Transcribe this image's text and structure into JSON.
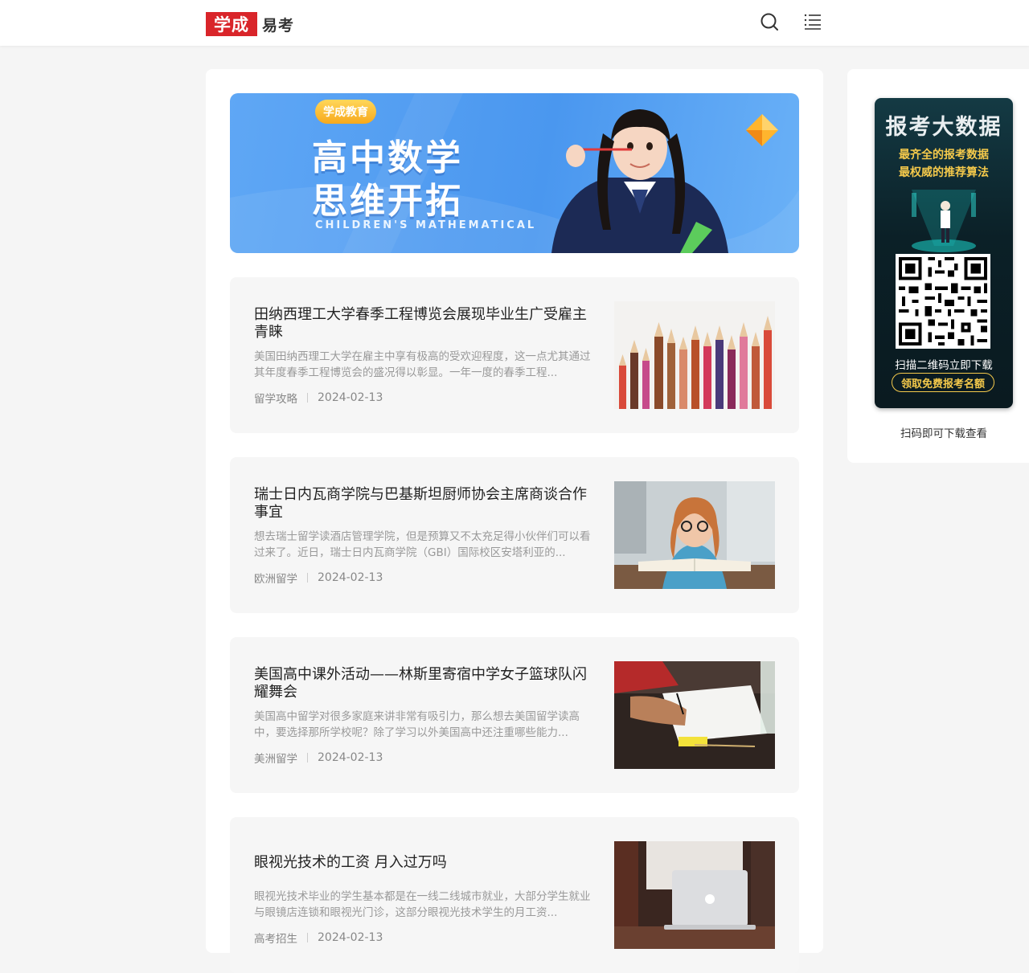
{
  "header": {
    "logo_part1": "学成",
    "logo_part2": "易考",
    "search_icon": "search-icon",
    "menu_icon": "list-menu-icon"
  },
  "banner": {
    "pill": "学成教育",
    "line1": "高中数学",
    "line2": "思维开拓",
    "subtitle_en": "CHILDREN'S MATHEMATICAL"
  },
  "articles": [
    {
      "title": "田纳西理工大学春季工程博览会展现毕业生广受雇主青睐",
      "desc": "美国田纳西理工大学在雇主中享有极高的受欢迎程度，这一点尤其通过其年度春季工程博览会的盛况得以彰显。一年一度的春季工程...",
      "category": "留学攻略",
      "date": "2024-02-13",
      "image": "colored-pencils-photo"
    },
    {
      "title": "瑞士日内瓦商学院与巴基斯坦厨师协会主席商谈合作事宜",
      "desc": "想去瑞士留学读酒店管理学院，但是预算又不太充足得小伙伴们可以看过来了。近日，瑞士日内瓦商学院（GBI）国际校区安塔利亚的...",
      "category": "欧洲留学",
      "date": "2024-02-13",
      "image": "girl-reading-photo"
    },
    {
      "title": "美国高中课外活动——林斯里寄宿中学女子篮球队闪耀舞会",
      "desc": "美国高中留学对很多家庭来讲非常有吸引力，那么想去美国留学读高中，要选择那所学校呢？除了学习以外美国高中还注重哪些能力...",
      "category": "美洲留学",
      "date": "2024-02-13",
      "image": "writing-desk-photo"
    },
    {
      "title": "眼视光技术的工资 月入过万吗",
      "desc": "眼视光技术毕业的学生基本都是在一线二线城市就业，大部分学生就业与眼镜店连锁和眼视光门诊，这部分眼视光技术学生的月工资...",
      "category": "高考招生",
      "date": "2024-02-13",
      "image": "laptop-photo"
    }
  ],
  "sidebar": {
    "ad_title": "报考大数据",
    "ad_sub1": "最齐全的报考数据",
    "ad_sub2": "最权威的推荐算法",
    "ad_scan": "扫描二维码立即下载",
    "ad_button": "领取免费报考名额",
    "caption": "扫码即可下载查看"
  },
  "colors": {
    "brand_red": "#d9252a",
    "banner_blue": "#4a97ef",
    "ad_gold": "#f4c94b",
    "page_bg": "#f5f5f5",
    "card_bg": "#f6f6f6"
  }
}
